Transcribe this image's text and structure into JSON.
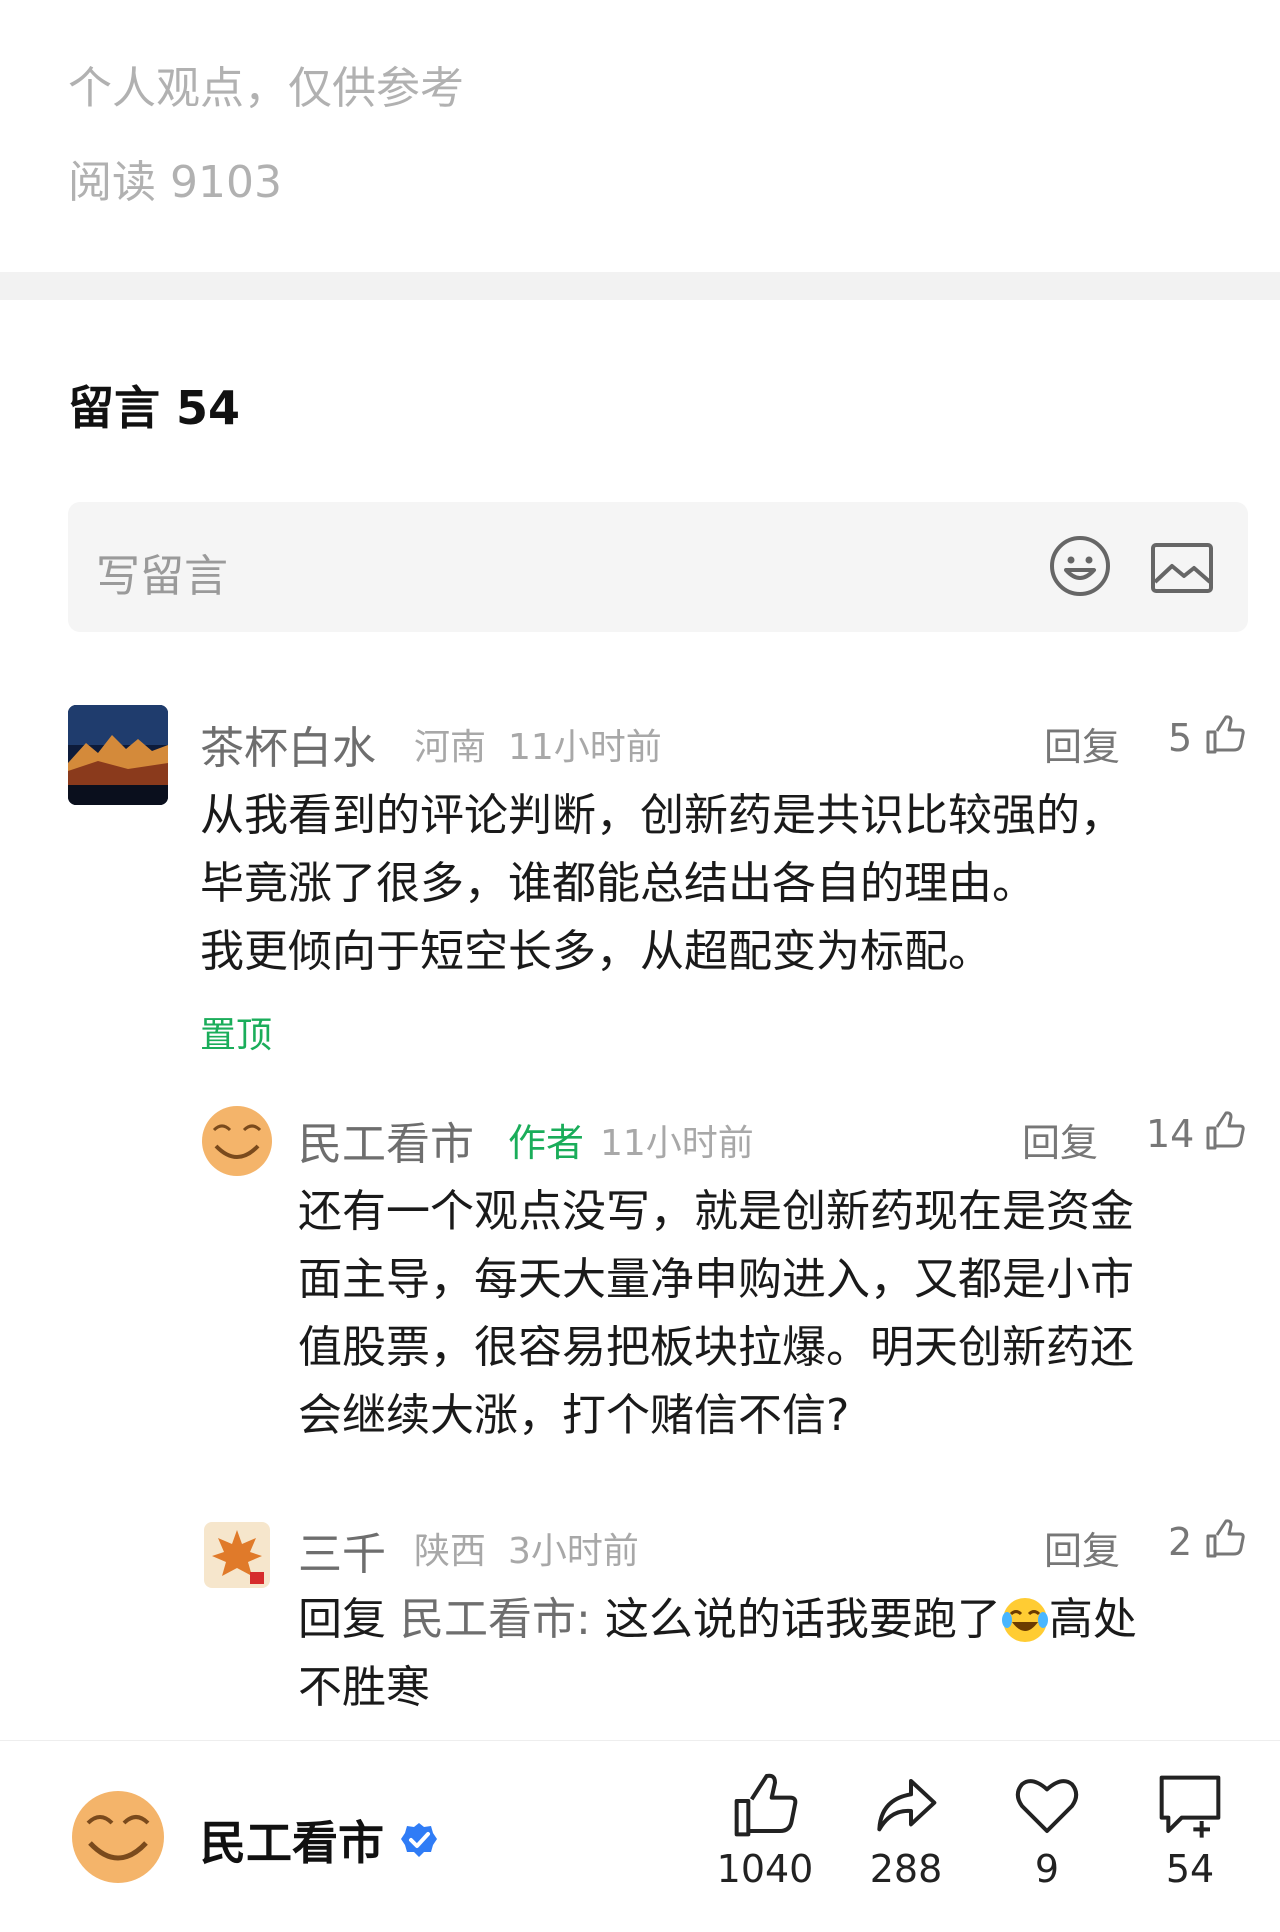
{
  "article": {
    "note": "个人观点，仅供参考",
    "reads": "阅读 9103"
  },
  "comments_section": {
    "title": "留言 54",
    "write_placeholder": "写留言"
  },
  "comments": [
    {
      "name": "茶杯白水",
      "location": "河南",
      "time": "11小时前",
      "reply_label": "回复",
      "likes": "5",
      "text_lines": [
        "从我看到的评论判断，创新药是共识比较强的，",
        "毕竟涨了很多，谁都能总结出各自的理由。",
        "我更倾向于短空长多，从超配变为标配。"
      ],
      "pinned_label": "置顶"
    },
    {
      "name": "民工看市",
      "author_tag": "作者",
      "time": "11小时前",
      "reply_label": "回复",
      "likes": "14",
      "text_lines": [
        "还有一个观点没写，就是创新药现在是资金",
        "面主导，每天大量净申购进入，又都是小市",
        "值股票，很容易把板块拉爆。明天创新药还",
        "会继续大涨，打个赌信不信?"
      ]
    },
    {
      "name": "三千",
      "location": "陕西",
      "time": "3小时前",
      "reply_label": "回复",
      "likes": "2",
      "reply_prefix": "回复",
      "reply_target": "民工看市:",
      "text_line1": "这么说的话我要跑了",
      "text_line1_end": "高处",
      "text_line2": "不胜寒"
    }
  ],
  "bottom_bar": {
    "account_name": "民工看市",
    "likes": "1040",
    "shares": "288",
    "favorites": "9",
    "comments": "54"
  },
  "colors": {
    "green": "#1aad5a",
    "verified": "#2f7cf6"
  }
}
